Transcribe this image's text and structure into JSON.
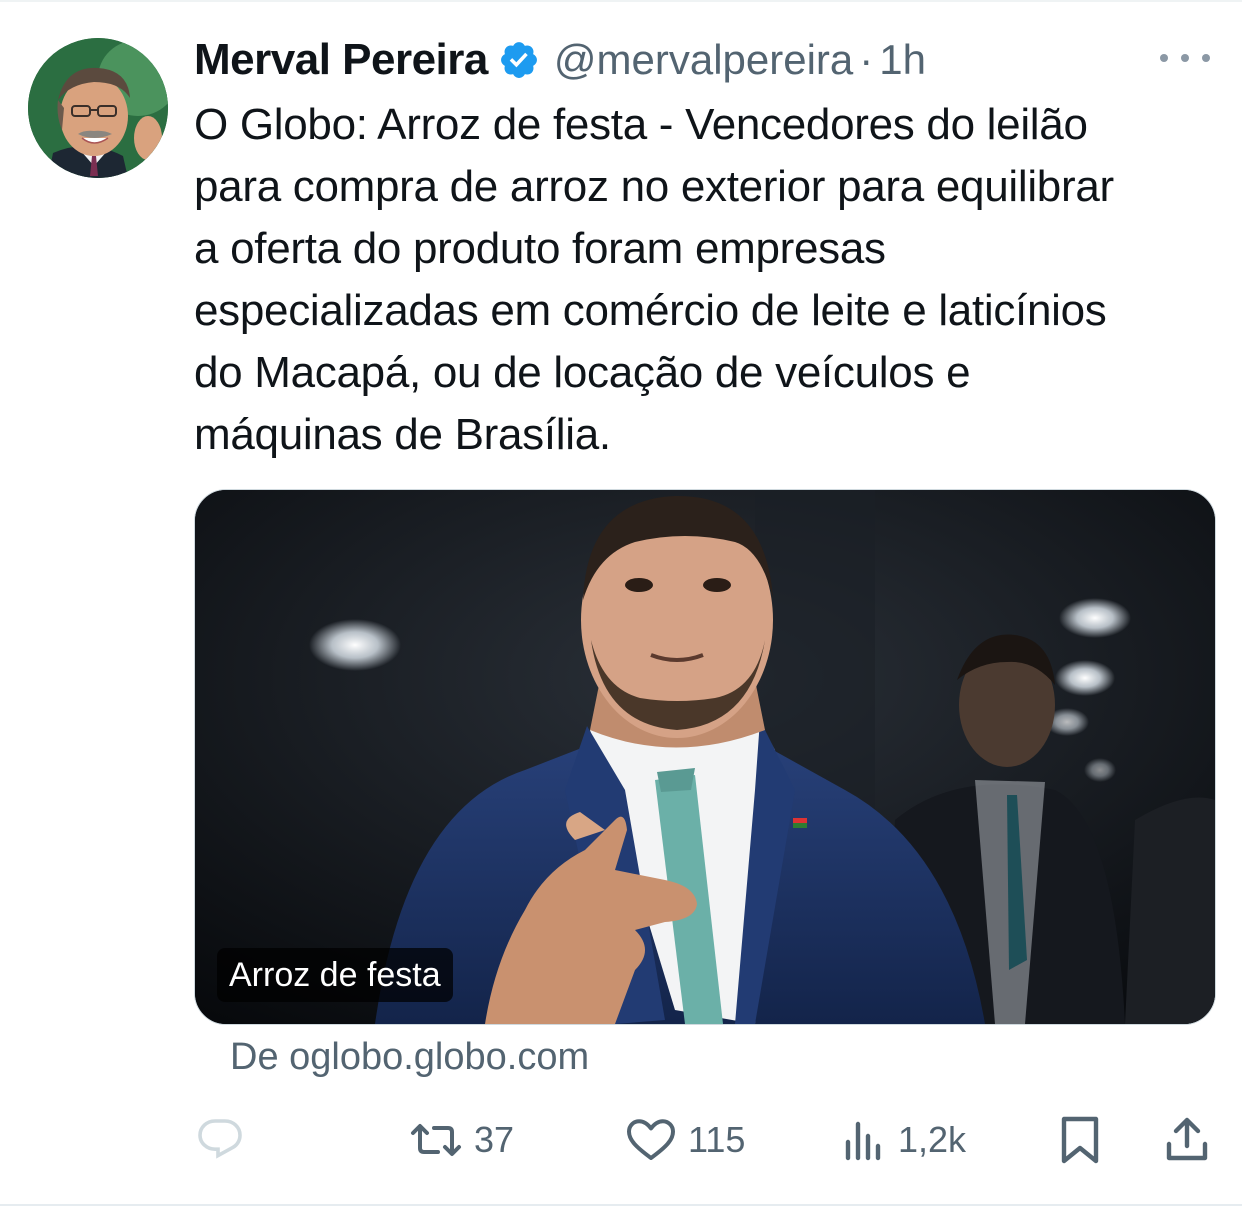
{
  "tweet": {
    "author_name": "Merval Pereira",
    "handle": "@mervalpereira",
    "separator": "·",
    "time": "1h",
    "text": "O Globo: Arroz de festa -  Vencedores do leilão\npara compra de arroz no exterior para equilibrar\na oferta do produto foram empresas\nespecializadas em comércio de leite e laticínios\ndo Macapá, ou de locação de veículos e\nmáquinas de Brasília.",
    "card": {
      "caption": "Arroz de festa",
      "source": "De oglobo.globo.com"
    }
  },
  "actions": {
    "reply_icon": "reply-icon",
    "retweet_count": "37",
    "like_count": "115",
    "views_count": "1,2k"
  },
  "colors": {
    "text_primary": "#0f1419",
    "text_secondary": "#536471",
    "verified": "#1d9bf0",
    "border": "#cfd9de"
  }
}
